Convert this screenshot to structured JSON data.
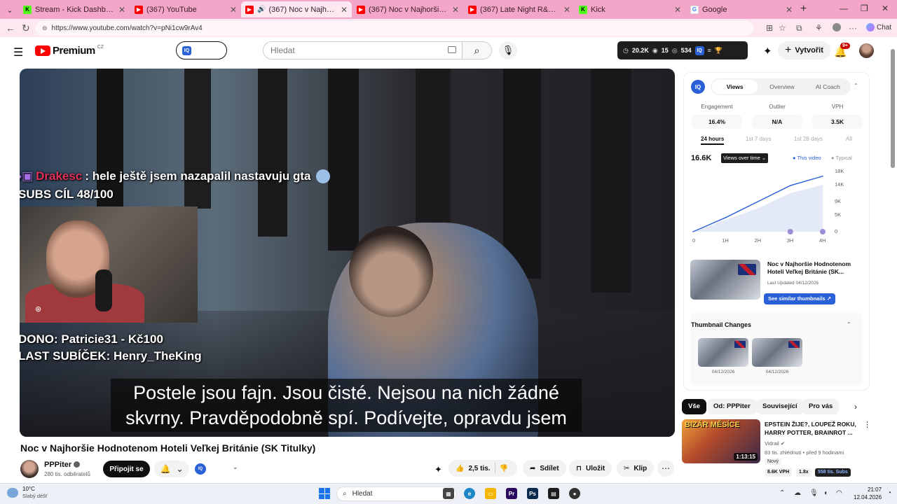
{
  "browser": {
    "tabs": [
      {
        "label": "Stream - Kick Dashboard",
        "favicon": "kick-icon",
        "color": "#53fc18",
        "active": false
      },
      {
        "label": "(367) YouTube",
        "favicon": "youtube-icon",
        "color": "#ff0000",
        "active": false
      },
      {
        "label": "(367) Noc v Najhoršie Hodnot",
        "favicon": "youtube-icon",
        "color": "#ff0000",
        "active": true
      },
      {
        "label": "(367) Noc v Najhoršie Hodnoteno",
        "favicon": "youtube-icon",
        "color": "#ff0000",
        "active": false
      },
      {
        "label": "(367) Late Night R&B Playlist Vol.",
        "favicon": "youtube-icon",
        "color": "#ff0000",
        "active": false
      },
      {
        "label": "Kick",
        "favicon": "kick-icon",
        "color": "#53fc18",
        "active": false
      },
      {
        "label": "Google",
        "favicon": "google-icon",
        "color": "#4285f4",
        "active": false
      }
    ],
    "url": "https://www.youtube.com/watch?v=pNi1cw9rAv4",
    "chat_label": "Chat"
  },
  "youtube": {
    "logo_text": "Premium",
    "country": "CZ",
    "search_placeholder": "Hledat",
    "stats": {
      "views": "20.2K",
      "watching": "15",
      "other": "534"
    },
    "create_label": "Vytvořit",
    "notif_count": "9+"
  },
  "video": {
    "chat_user": "Drakesc",
    "chat_message": ": hele ještě jsem nazapalil nastavuju gta",
    "subs_goal": "SUBS CÍL 48/100",
    "dono": "DONO: Patricie31 - Kč100",
    "last_sub": "LAST SUBÍČEK: Henry_TheKing",
    "caption_line1": "Postele jsou fajn. Jsou čisté. Nejsou na nich žádné",
    "caption_line2": "skvrny. Pravděpodobně spí. Podívejte, opravdu jsem",
    "title": "Noc v Najhoršie Hodnotenom Hoteli Veľkej Británie (SK Titulky)",
    "channel": "PPPiter",
    "subscribers": "280 tis. odběratelů",
    "join_label": "Připojit se",
    "likes": "2,5 tis.",
    "share_label": "Sdílet",
    "save_label": "Uložit",
    "clip_label": "Klip"
  },
  "panel": {
    "tabs": [
      "Views",
      "Overview",
      "AI Coach"
    ],
    "active_tab": "Views",
    "metrics": [
      {
        "label": "Engagement",
        "value": "16.4%"
      },
      {
        "label": "Outlier",
        "value": "N/A"
      },
      {
        "label": "VPH",
        "value": "3.5K"
      }
    ],
    "ranges": [
      "24 hours",
      "1st 7 days",
      "1st 28 days",
      "All"
    ],
    "active_range": "24 hours",
    "chart_total": "16.6K",
    "chart_select": "Views over time",
    "legend_this": "● This video",
    "legend_typical": "● Typical",
    "thumb_title": "Noc v Najhoršie Hodnotenom Hoteli Veľkej Británie (SK...",
    "thumb_updated": "Last Updated 04/12/2026",
    "similar_btn": "See similar thumbnails ↗",
    "thumb_changes_title": "Thumbnail Changes",
    "thumb_change_dates": [
      "04/12/2026",
      "04/12/2026"
    ]
  },
  "chart_data": {
    "type": "area",
    "title": "",
    "x": [
      "0",
      "1H",
      "2H",
      "3H",
      "4H"
    ],
    "series": [
      {
        "name": "This video",
        "values": [
          0,
          4200,
          9000,
          13800,
          16600
        ]
      },
      {
        "values": [
          0,
          3500,
          7000,
          11500,
          14000
        ]
      }
    ],
    "yticks": [
      "18K",
      "14K",
      "9K",
      "5K",
      "0"
    ],
    "ylim": [
      0,
      18000
    ],
    "accent": "#2b61d8",
    "grid": false,
    "legend_position": "top-right"
  },
  "chips": [
    "Vše",
    "Od: PPPiter",
    "Související",
    "Pro vás"
  ],
  "recommended": {
    "thumb_text": "BIZÁR MĚSÍCE",
    "title": "EPSTEIN ŽIJE?, LOUPEŽ ROKU, HARRY POTTER, BRAINROT ...",
    "channel": "Vidrail",
    "meta": "83 tis. zhlédnutí • před 9 hodinami",
    "badge_new": "Nový",
    "duration": "1:13:15",
    "vph": "8.6K VPH",
    "multiplier": "1.8x",
    "subs": "558 tis. Subs"
  },
  "taskbar": {
    "temp": "10°C",
    "weather": "Slabý déšť",
    "search": "Hledat",
    "time": "21:07",
    "date": "12.04.2026"
  }
}
